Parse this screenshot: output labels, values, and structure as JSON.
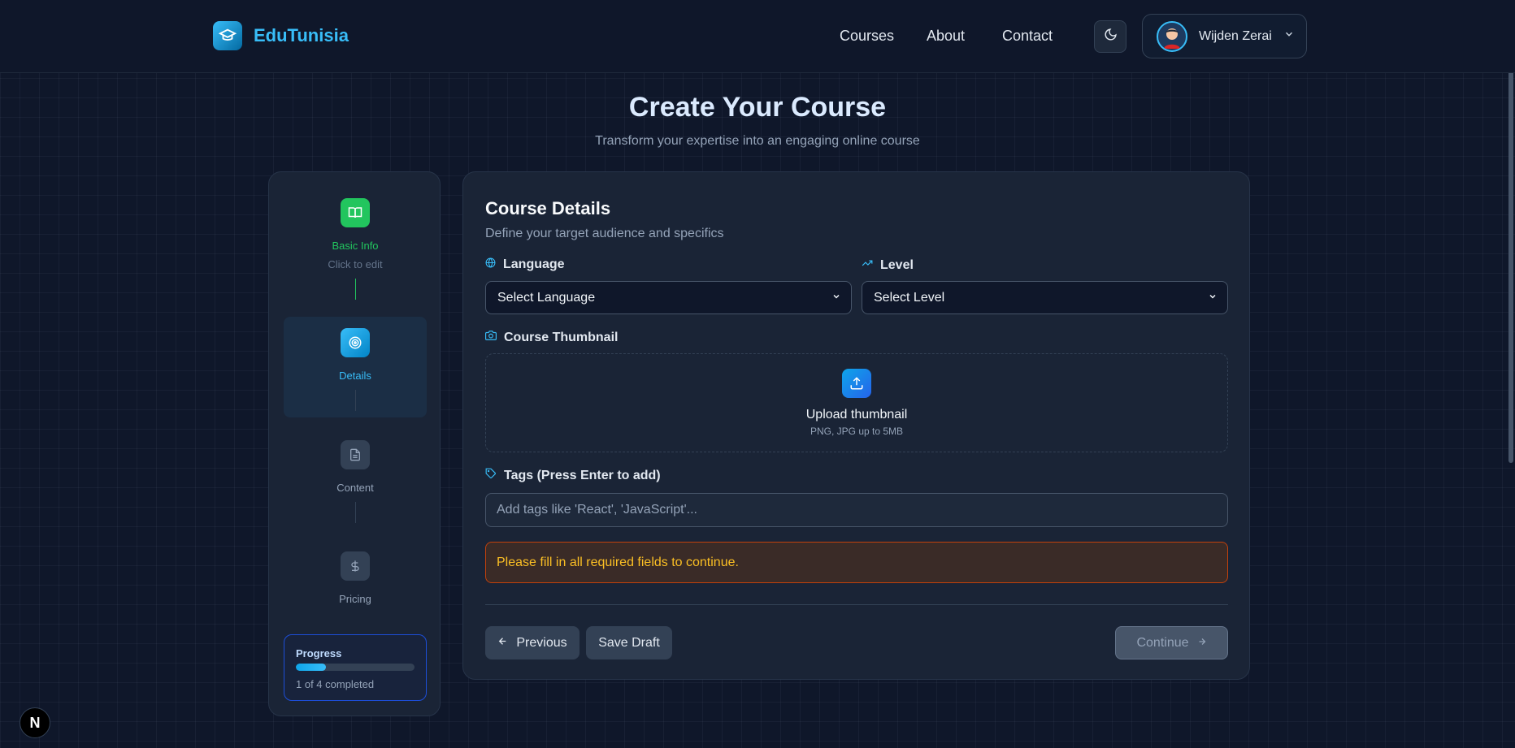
{
  "header": {
    "brand": "EduTunisia",
    "nav": [
      {
        "label": "Courses"
      },
      {
        "label": "About"
      },
      {
        "label": "Contact"
      }
    ],
    "user": {
      "name": "Wijden Zerai"
    }
  },
  "page": {
    "title": "Create Your Course",
    "subtitle": "Transform your expertise into an engaging online course"
  },
  "steps": [
    {
      "label": "Basic Info",
      "sub": "Click to edit",
      "state": "completed",
      "icon": "book-open-icon",
      "color": "#22c55e"
    },
    {
      "label": "Details",
      "sub": "",
      "state": "active",
      "icon": "target-icon",
      "color": "#38bdf8"
    },
    {
      "label": "Content",
      "sub": "",
      "state": "pending",
      "icon": "file-text-icon",
      "color": "#94a3b8"
    },
    {
      "label": "Pricing",
      "sub": "",
      "state": "pending",
      "icon": "dollar-icon",
      "color": "#94a3b8"
    }
  ],
  "progress": {
    "title": "Progress",
    "text": "1 of 4 completed",
    "fraction": 0.25
  },
  "form": {
    "title": "Course Details",
    "subtitle": "Define your target audience and specifics",
    "language": {
      "label": "Language",
      "value": "Select Language"
    },
    "level": {
      "label": "Level",
      "value": "Select Level"
    },
    "thumbnail": {
      "label": "Course Thumbnail",
      "upload_title": "Upload thumbnail",
      "upload_hint": "PNG, JPG up to 5MB"
    },
    "tags": {
      "label": "Tags (Press Enter to add)",
      "placeholder": "Add tags like 'React', 'JavaScript'..."
    },
    "alert": "Please fill in all required fields to continue.",
    "buttons": {
      "previous": "Previous",
      "save_draft": "Save Draft",
      "continue": "Continue"
    }
  },
  "colors": {
    "accent": "#38bdf8",
    "success": "#22c55e",
    "warning": "#fbbf24",
    "background": "#0f172a"
  }
}
